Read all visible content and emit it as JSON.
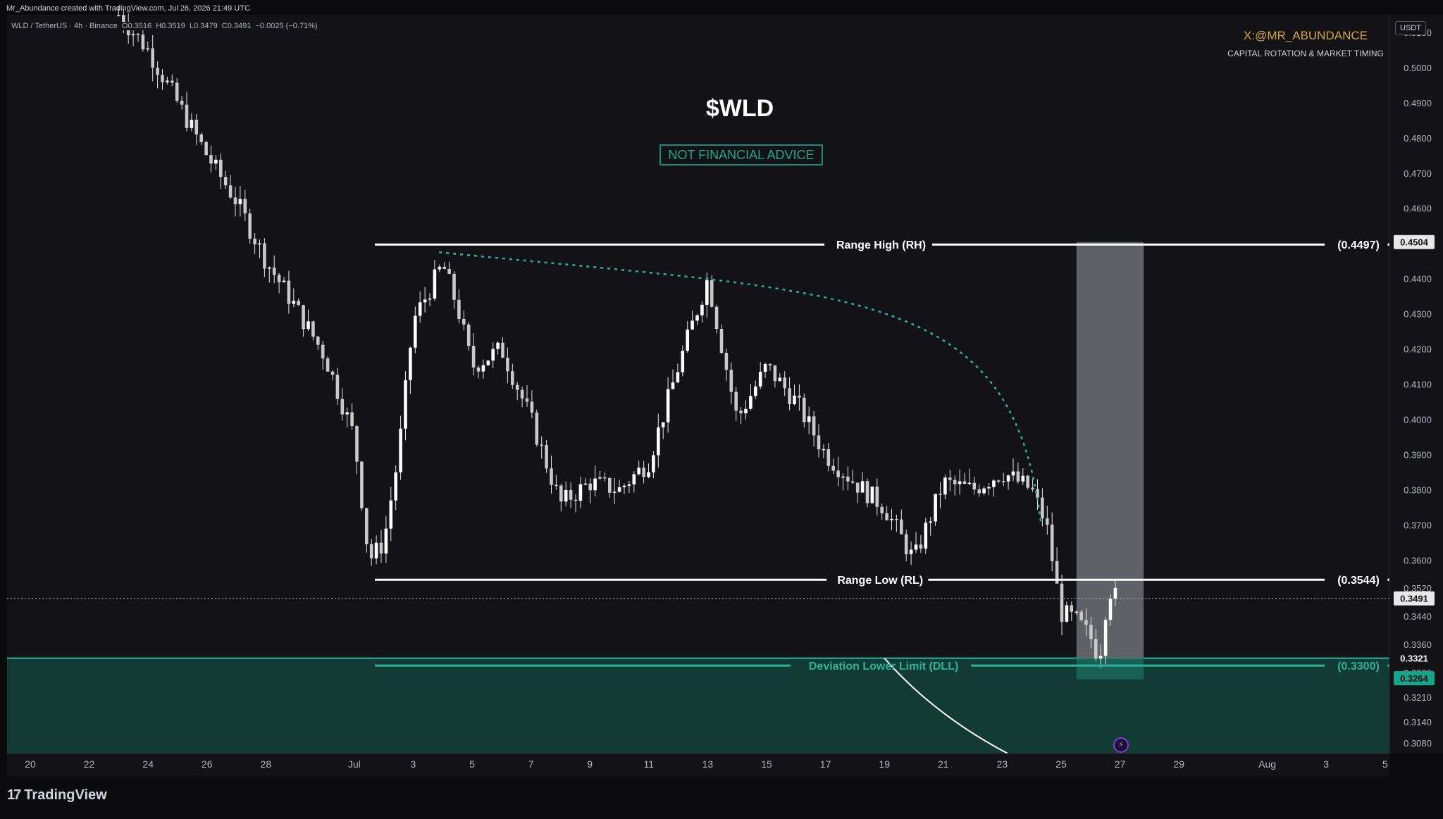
{
  "header": {
    "credit": "Mr_Abundance created with TradingView.com, Jul 26, 2026 21:49 UTC",
    "symbol_line": "WLD / TetherUS · 4h · Binance  O0.3516  H0.3519  L0.3479  C0.3491  −0.0025 (−0.71%)"
  },
  "price_axis": {
    "currency": "USDT",
    "tick_labels": [
      "0.5100",
      "0.5000",
      "0.4900",
      "0.4800",
      "0.4700",
      "0.4600",
      "0.4400",
      "0.4300",
      "0.4200",
      "0.4100",
      "0.4000",
      "0.3900",
      "0.3800",
      "0.3700",
      "0.3600",
      "0.3520",
      "0.3440",
      "0.3360",
      "0.3280",
      "0.3210",
      "0.3140",
      "0.3080"
    ],
    "badges": [
      {
        "label": "0.4504",
        "style": "light"
      },
      {
        "label": "0.3491",
        "style": "light"
      },
      {
        "label": "0.3321",
        "style": "dark"
      },
      {
        "label": "0.3264",
        "style": "teal"
      }
    ]
  },
  "annotations": {
    "handle": "X:@MR_ABUNDANCE",
    "tagline": "CAPITAL ROTATION & MARKET TIMING",
    "ticker_title": "$WLD",
    "disclaimer": "NOT FINANCIAL ADVICE",
    "range_high_label": "Range High (RH)",
    "range_high_value": "(0.4497)",
    "range_low_label": "Range Low (RL)",
    "range_low_value": "(0.3544)",
    "dll_label": "Deviation Lower Limit (DLL)",
    "dll_value": "(0.3300)"
  },
  "time_axis": {
    "labels": [
      "20",
      "22",
      "24",
      "26",
      "28",
      "Jul",
      "3",
      "5",
      "7",
      "9",
      "11",
      "13",
      "15",
      "17",
      "19",
      "21",
      "23",
      "25",
      "27",
      "29",
      "Aug",
      "3",
      "5"
    ]
  },
  "footer": {
    "brand": "TradingView",
    "logo_glyph": "17",
    "lightning_glyph": "⚡"
  },
  "colors": {
    "background": "#131317",
    "candle": "#e6e6e6",
    "teal": "#2bb39a",
    "zone": "#133b36",
    "range_line": "#ffffff",
    "handle": "#d4a640"
  },
  "chart_data": {
    "type": "candlestick",
    "symbol": "WLD/USDT",
    "interval": "4h",
    "exchange": "Binance",
    "ylim": [
      0.305,
      0.515
    ],
    "levels": {
      "range_high": 0.4497,
      "range_low": 0.3544,
      "deviation_lower_limit": 0.33,
      "current": 0.3491
    },
    "time_axis_dates": [
      "Jun 20",
      "Jun 22",
      "Jun 24",
      "Jun 26",
      "Jun 28",
      "Jul 1",
      "Jul 3",
      "Jul 5",
      "Jul 7",
      "Jul 9",
      "Jul 11",
      "Jul 13",
      "Jul 15",
      "Jul 17",
      "Jul 19",
      "Jul 21",
      "Jul 23",
      "Jul 25",
      "Jul 27",
      "Jul 29",
      "Aug 1",
      "Aug 3",
      "Aug 5"
    ],
    "price_path": [
      [
        "Jun 23",
        0.515
      ],
      [
        "Jun 24",
        0.505
      ],
      [
        "Jun 25",
        0.49
      ],
      [
        "Jun 26",
        0.475
      ],
      [
        "Jun 27",
        0.462
      ],
      [
        "Jun 28",
        0.445
      ],
      [
        "Jun 29",
        0.432
      ],
      [
        "Jun 30",
        0.418
      ],
      [
        "Jul 1",
        0.395
      ],
      [
        "Jul 1.5",
        0.36
      ],
      [
        "Jul 2",
        0.365
      ],
      [
        "Jul 2.5",
        0.39
      ],
      [
        "Jul 3",
        0.428
      ],
      [
        "Jul 4",
        0.444
      ],
      [
        "Jul 4.5",
        0.432
      ],
      [
        "Jul 5",
        0.415
      ],
      [
        "Jul 6",
        0.42
      ],
      [
        "Jul 7",
        0.4
      ],
      [
        "Jul 8",
        0.376
      ],
      [
        "Jul 9",
        0.382
      ],
      [
        "Jul 10",
        0.38
      ],
      [
        "Jul 11",
        0.388
      ],
      [
        "Jul 12",
        0.415
      ],
      [
        "Jul 13",
        0.44
      ],
      [
        "Jul 14",
        0.4
      ],
      [
        "Jul 15",
        0.415
      ],
      [
        "Jul 16",
        0.405
      ],
      [
        "Jul 17",
        0.39
      ],
      [
        "Jul 18",
        0.382
      ],
      [
        "Jul 19",
        0.375
      ],
      [
        "Jul 20",
        0.36
      ],
      [
        "Jul 21",
        0.382
      ],
      [
        "Jul 22",
        0.38
      ],
      [
        "Jul 23",
        0.385
      ],
      [
        "Jul 24",
        0.38
      ],
      [
        "Jul 24.5",
        0.37
      ],
      [
        "Jul 25",
        0.345
      ],
      [
        "Jul 25.5",
        0.343
      ],
      [
        "Jul 26",
        0.338
      ],
      [
        "Jul 26.3",
        0.332
      ],
      [
        "Jul 26.6",
        0.352
      ],
      [
        "Jul 26.9",
        0.3491
      ]
    ],
    "drawings": [
      {
        "type": "horizontal",
        "label": "Range High (RH)",
        "value": 0.4497
      },
      {
        "type": "horizontal",
        "label": "Range Low (RL)",
        "value": 0.3544
      },
      {
        "type": "horizontal",
        "label": "Deviation Lower Limit (DLL)",
        "value": 0.33
      },
      {
        "type": "dotted-curve",
        "from": [
          "Jul 4",
          0.4475
        ],
        "to": [
          "Jul 24.8",
          0.37
        ]
      },
      {
        "type": "zone",
        "from_value": 0.3321,
        "to_value": 0.305
      },
      {
        "type": "box",
        "from": "Jul 26",
        "to": "Jul 29",
        "top": 0.4504,
        "bottom": 0.3321
      }
    ]
  }
}
